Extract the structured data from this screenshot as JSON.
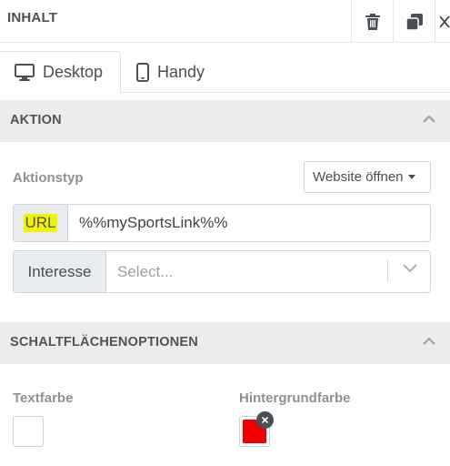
{
  "header": {
    "title": "INHALT"
  },
  "tabs": [
    {
      "label": "Desktop",
      "icon": "monitor-icon",
      "active": true
    },
    {
      "label": "Handy",
      "icon": "phone-icon",
      "active": false
    }
  ],
  "aktion": {
    "section_title": "AKTION",
    "aktionstyp_label": "Aktionstyp",
    "aktionstyp_value": "Website öffnen",
    "url_label": "URL",
    "url_value": "%%mySportsLink%%",
    "interesse_label": "Interesse",
    "interesse_placeholder": "Select..."
  },
  "schaltflaechen": {
    "section_title": "SCHALTFLÄCHENOPTIONEN",
    "textfarbe_label": "Textfarbe",
    "textfarbe_color": "#ffffff",
    "hintergrund_label": "Hintergrundfarbe",
    "hintergrund_color": "#ee0000"
  },
  "colors": {
    "url_highlight": "#f4f400",
    "section_bg": "#ececec"
  }
}
